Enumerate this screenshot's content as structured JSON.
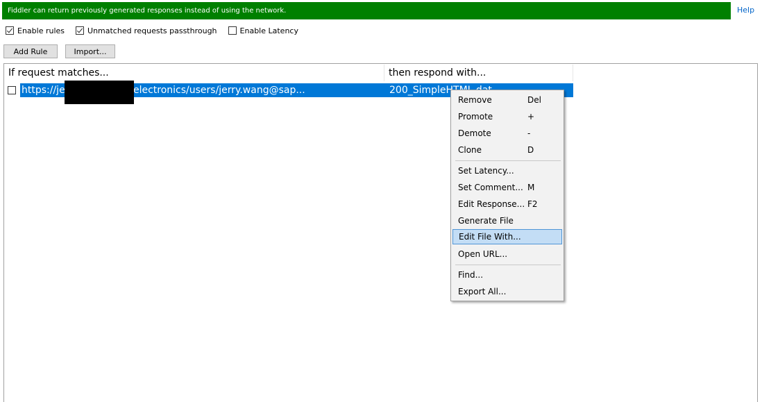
{
  "banner": {
    "text": "Fiddler can return previously generated responses instead of using the network."
  },
  "help_label": "Help",
  "options": {
    "enable_rules": {
      "label": "Enable rules",
      "checked": true
    },
    "unmatched_passthrough": {
      "label": "Unmatched requests passthrough",
      "checked": true
    },
    "enable_latency": {
      "label": "Enable Latency",
      "checked": false
    }
  },
  "buttons": {
    "add_rule": "Add Rule",
    "import": "Import..."
  },
  "grid": {
    "columns": [
      "If request matches...",
      "then respond with..."
    ],
    "rows": [
      {
        "match": "https://je                              9002/rest/v2/electronics/users/jerry.wang@sap...",
        "response": "200_SimpleHTML.dat",
        "checked": false,
        "selected": true
      }
    ]
  },
  "context_menu": {
    "items": [
      {
        "label": "Remove",
        "shortcut": "Del"
      },
      {
        "label": "Promote",
        "shortcut": "+"
      },
      {
        "label": "Demote",
        "shortcut": "-"
      },
      {
        "label": "Clone",
        "shortcut": "D"
      },
      {
        "label": "Set Latency...",
        "shortcut": ""
      },
      {
        "label": "Set Comment...",
        "shortcut": "M"
      },
      {
        "label": "Edit Response...",
        "shortcut": "F2"
      },
      {
        "label": "Generate File",
        "shortcut": ""
      },
      {
        "label": "Edit File With...",
        "shortcut": "",
        "highlighted": true
      },
      {
        "label": "Open URL...",
        "shortcut": ""
      },
      {
        "label": "Find...",
        "shortcut": ""
      },
      {
        "label": "Export All...",
        "shortcut": ""
      }
    ]
  },
  "colors": {
    "banner_bg": "#008000",
    "selection": "#0078d7",
    "menu_highlight": "#c3ddf5",
    "link": "#0063c8"
  }
}
